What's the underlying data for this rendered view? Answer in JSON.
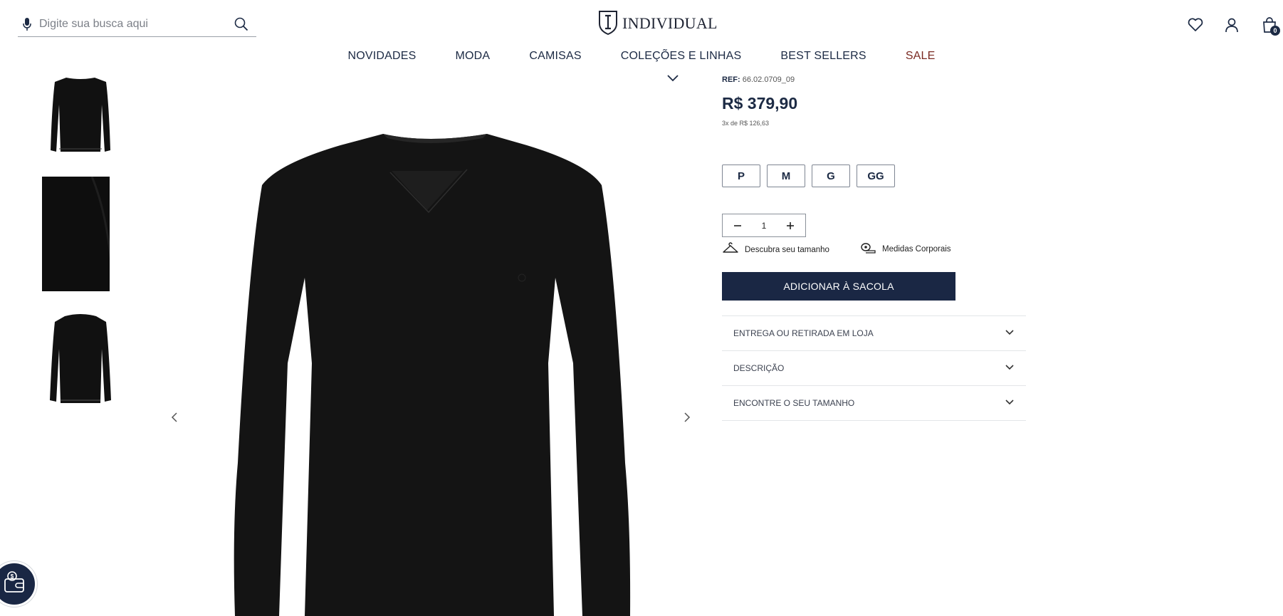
{
  "header": {
    "search_placeholder": "Digite sua busca aqui",
    "brand": "INDIVIDUAL",
    "cart_count": "0"
  },
  "nav": {
    "items": [
      "NOVIDADES",
      "MODA",
      "CAMISAS",
      "COLEÇÕES E LINHAS",
      "BEST SELLERS",
      "SALE"
    ],
    "sale_color": "#7a2a22"
  },
  "product": {
    "ref_label": "REF:",
    "ref_value": "66.02.0709_09",
    "price": "R$ 379,90",
    "installments": "3x de R$ 126,63",
    "sizes": [
      "P",
      "M",
      "G",
      "GG"
    ],
    "quantity": "1",
    "size_guide": "Descubra seu tamanho",
    "body_measures": "Medidas Corporais",
    "add_to_bag": "ADICIONAR À SACOLA",
    "accordion": [
      "ENTREGA OU RETIRADA EM LOJA",
      "DESCRIÇÃO",
      "ENCONTRE O SEU TAMANHO"
    ]
  },
  "colors": {
    "primary": "#1a2744",
    "product": "#141414"
  }
}
